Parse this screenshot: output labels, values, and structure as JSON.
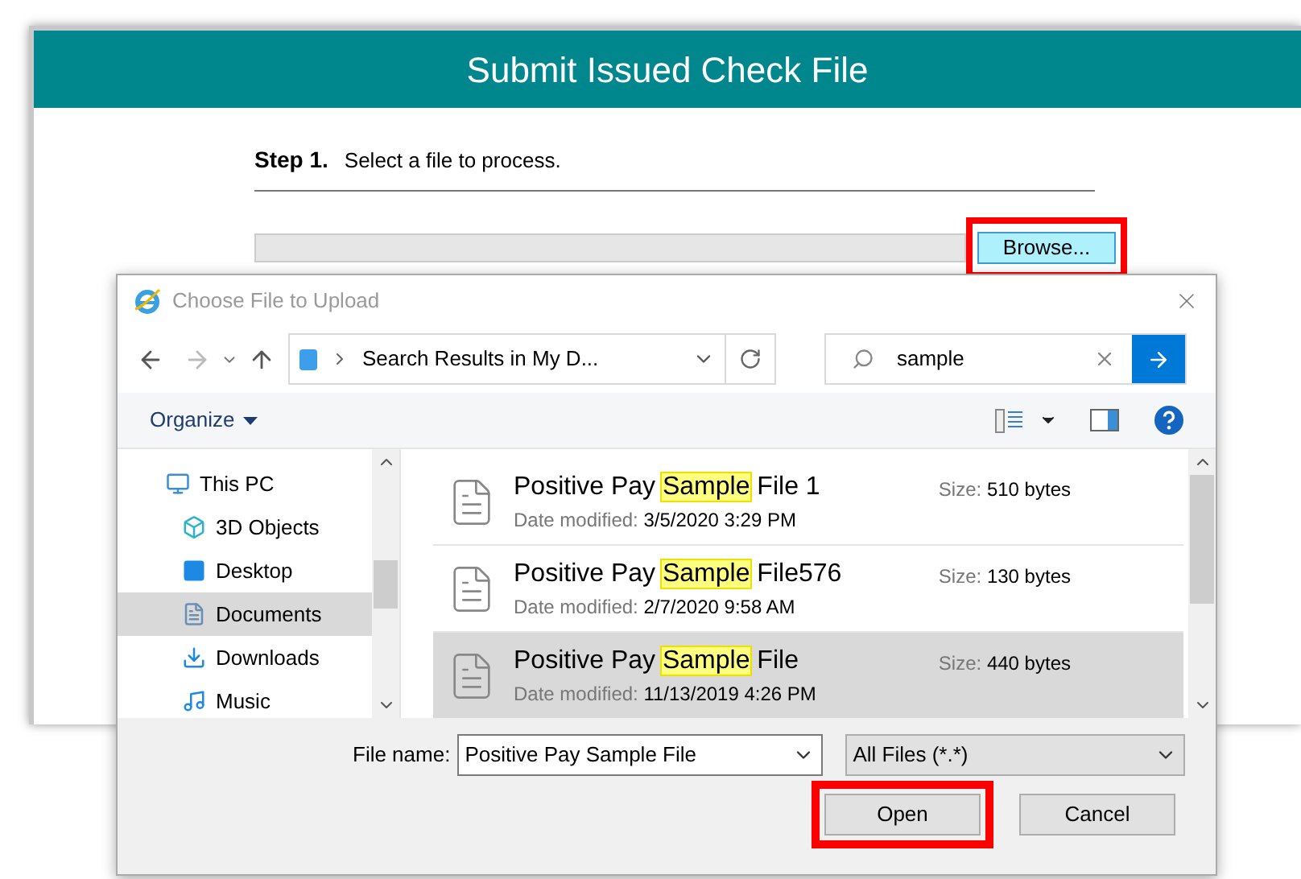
{
  "page": {
    "title": "Submit Issued Check File",
    "step": {
      "number": "Step 1.",
      "text": "Select a file to process."
    },
    "browse_button": {
      "label": "Browse...",
      "highlighted": true
    }
  },
  "dialog": {
    "title": "Choose File to Upload",
    "address": "Search Results in My D...",
    "search": {
      "value": "sample"
    },
    "organize": "Organize",
    "nav": [
      {
        "label": "This PC",
        "kind": "pc",
        "selected": false,
        "children": [
          {
            "label": "3D Objects",
            "kind": "objects",
            "selected": false
          },
          {
            "label": "Desktop",
            "kind": "desktop",
            "selected": false
          },
          {
            "label": "Documents",
            "kind": "documents",
            "selected": true
          },
          {
            "label": "Downloads",
            "kind": "downloads",
            "selected": false
          },
          {
            "label": "Music",
            "kind": "music",
            "selected": false
          }
        ]
      }
    ],
    "files": [
      {
        "name_before": "Positive Pay ",
        "name_match": "Sample",
        "name_after": " File 1",
        "date_label": "Date modified:",
        "date": "3/5/2020 3:29 PM",
        "size_label": "Size:",
        "size": "510 bytes",
        "selected": false
      },
      {
        "name_before": "Positive Pay ",
        "name_match": "Sample",
        "name_after": " File576",
        "date_label": "Date modified:",
        "date": "2/7/2020 9:58 AM",
        "size_label": "Size:",
        "size": "130 bytes",
        "selected": false
      },
      {
        "name_before": "Positive Pay ",
        "name_match": "Sample",
        "name_after": " File",
        "date_label": "Date modified:",
        "date": "11/13/2019 4:26 PM",
        "size_label": "Size:",
        "size": "440 bytes",
        "selected": true
      }
    ],
    "file_name_label": "File name:",
    "file_name": "Positive Pay Sample File",
    "filter": "All Files (*.*)",
    "buttons": [
      {
        "label": "Open",
        "highlighted": true
      },
      {
        "label": "Cancel",
        "highlighted": false
      }
    ]
  }
}
